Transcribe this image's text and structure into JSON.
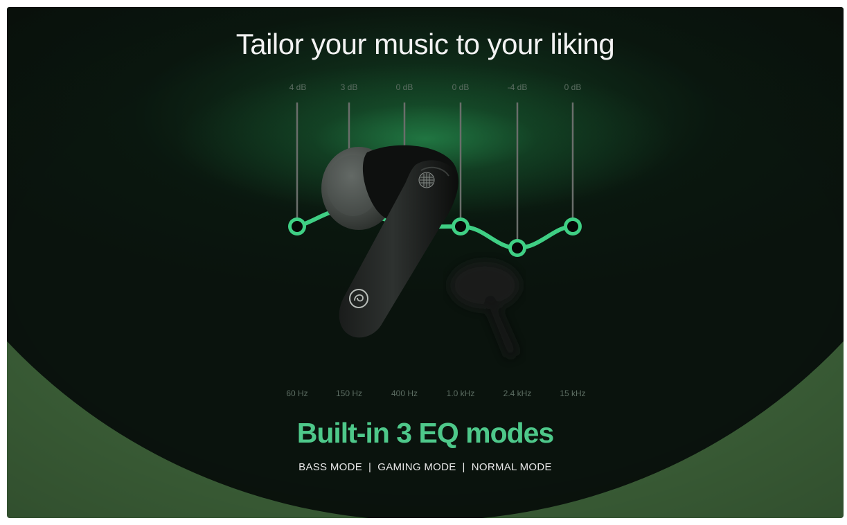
{
  "headline": "Tailor your music to your liking",
  "eq": {
    "bands": [
      {
        "db_label": "4 dB",
        "hz_label": "60 Hz"
      },
      {
        "db_label": "3 dB",
        "hz_label": "150 Hz"
      },
      {
        "db_label": "0 dB",
        "hz_label": "400 Hz"
      },
      {
        "db_label": "0 dB",
        "hz_label": "1.0 kHz"
      },
      {
        "db_label": "-4 dB",
        "hz_label": "2.4 kHz"
      },
      {
        "db_label": "0 dB",
        "hz_label": "15 kHz"
      }
    ]
  },
  "feature_heading": "Built-in 3 EQ modes",
  "modes": [
    "BASS MODE",
    "GAMING MODE",
    "NORMAL MODE"
  ],
  "colors": {
    "accent_green": "#4ec88a",
    "background_dark": "#0a130d",
    "background_olive": "#3a5d36"
  },
  "product_image": "earbuds-icon"
}
